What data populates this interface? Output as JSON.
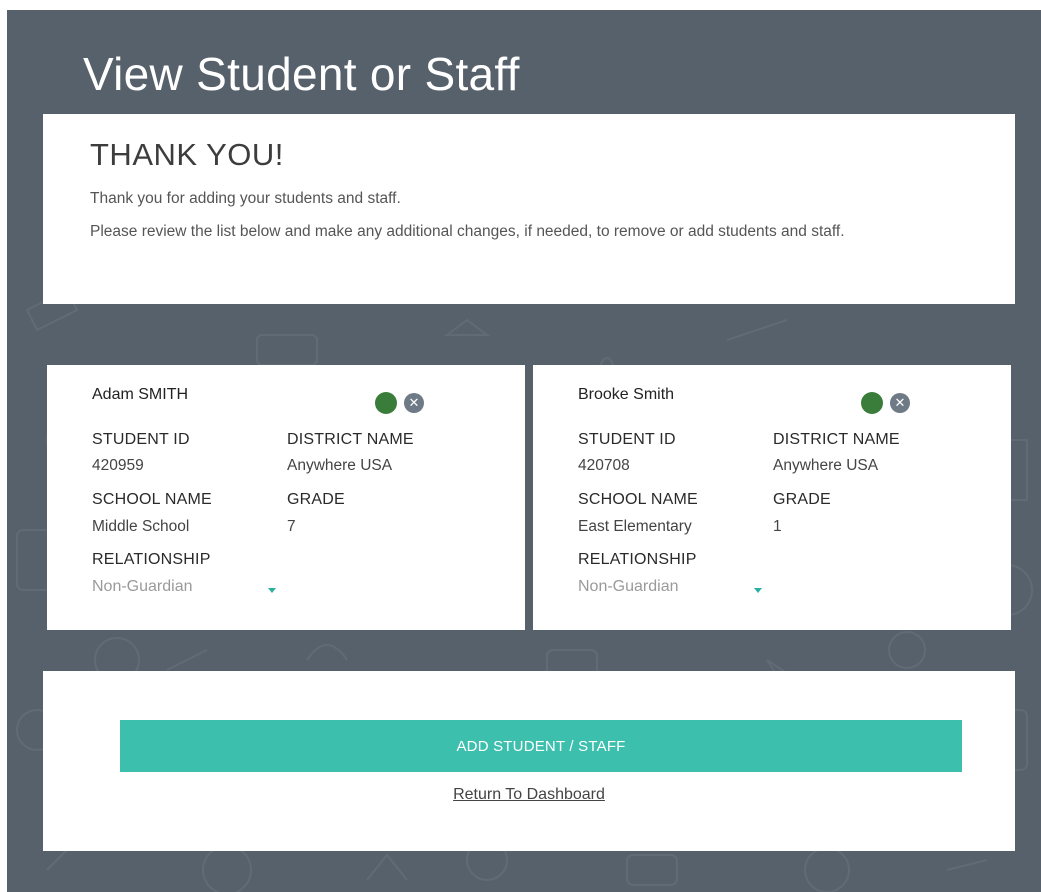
{
  "page": {
    "title": "View Student or Staff"
  },
  "thanks": {
    "heading": "THANK YOU!",
    "line1": "Thank you for adding your students and staff.",
    "line2": "Please review the list below and make any additional changes, if needed, to remove or add students and staff."
  },
  "labels": {
    "student_id": "STUDENT ID",
    "district_name": "DISTRICT NAME",
    "school_name": "SCHOOL NAME",
    "grade": "GRADE",
    "relationship": "RELATIONSHIP"
  },
  "students": [
    {
      "name": "Adam SMITH",
      "student_id": "420959",
      "district_name": "Anywhere USA",
      "school_name": "Middle School",
      "grade": "7",
      "relationship": "Non-Guardian"
    },
    {
      "name": "Brooke Smith",
      "student_id": "420708",
      "district_name": "Anywhere USA",
      "school_name": "East Elementary",
      "grade": "1",
      "relationship": "Non-Guardian"
    }
  ],
  "actions": {
    "add_label": "ADD STUDENT / STAFF",
    "return_label": "Return To Dashboard"
  },
  "icons": {
    "status": "status-dot-icon",
    "remove": "close-circle-icon",
    "dropdown": "caret-down-icon"
  },
  "colors": {
    "background": "#56616b",
    "accent": "#3dbfae",
    "status_active": "#3a7d3a",
    "remove_icon": "#6e7a86"
  }
}
